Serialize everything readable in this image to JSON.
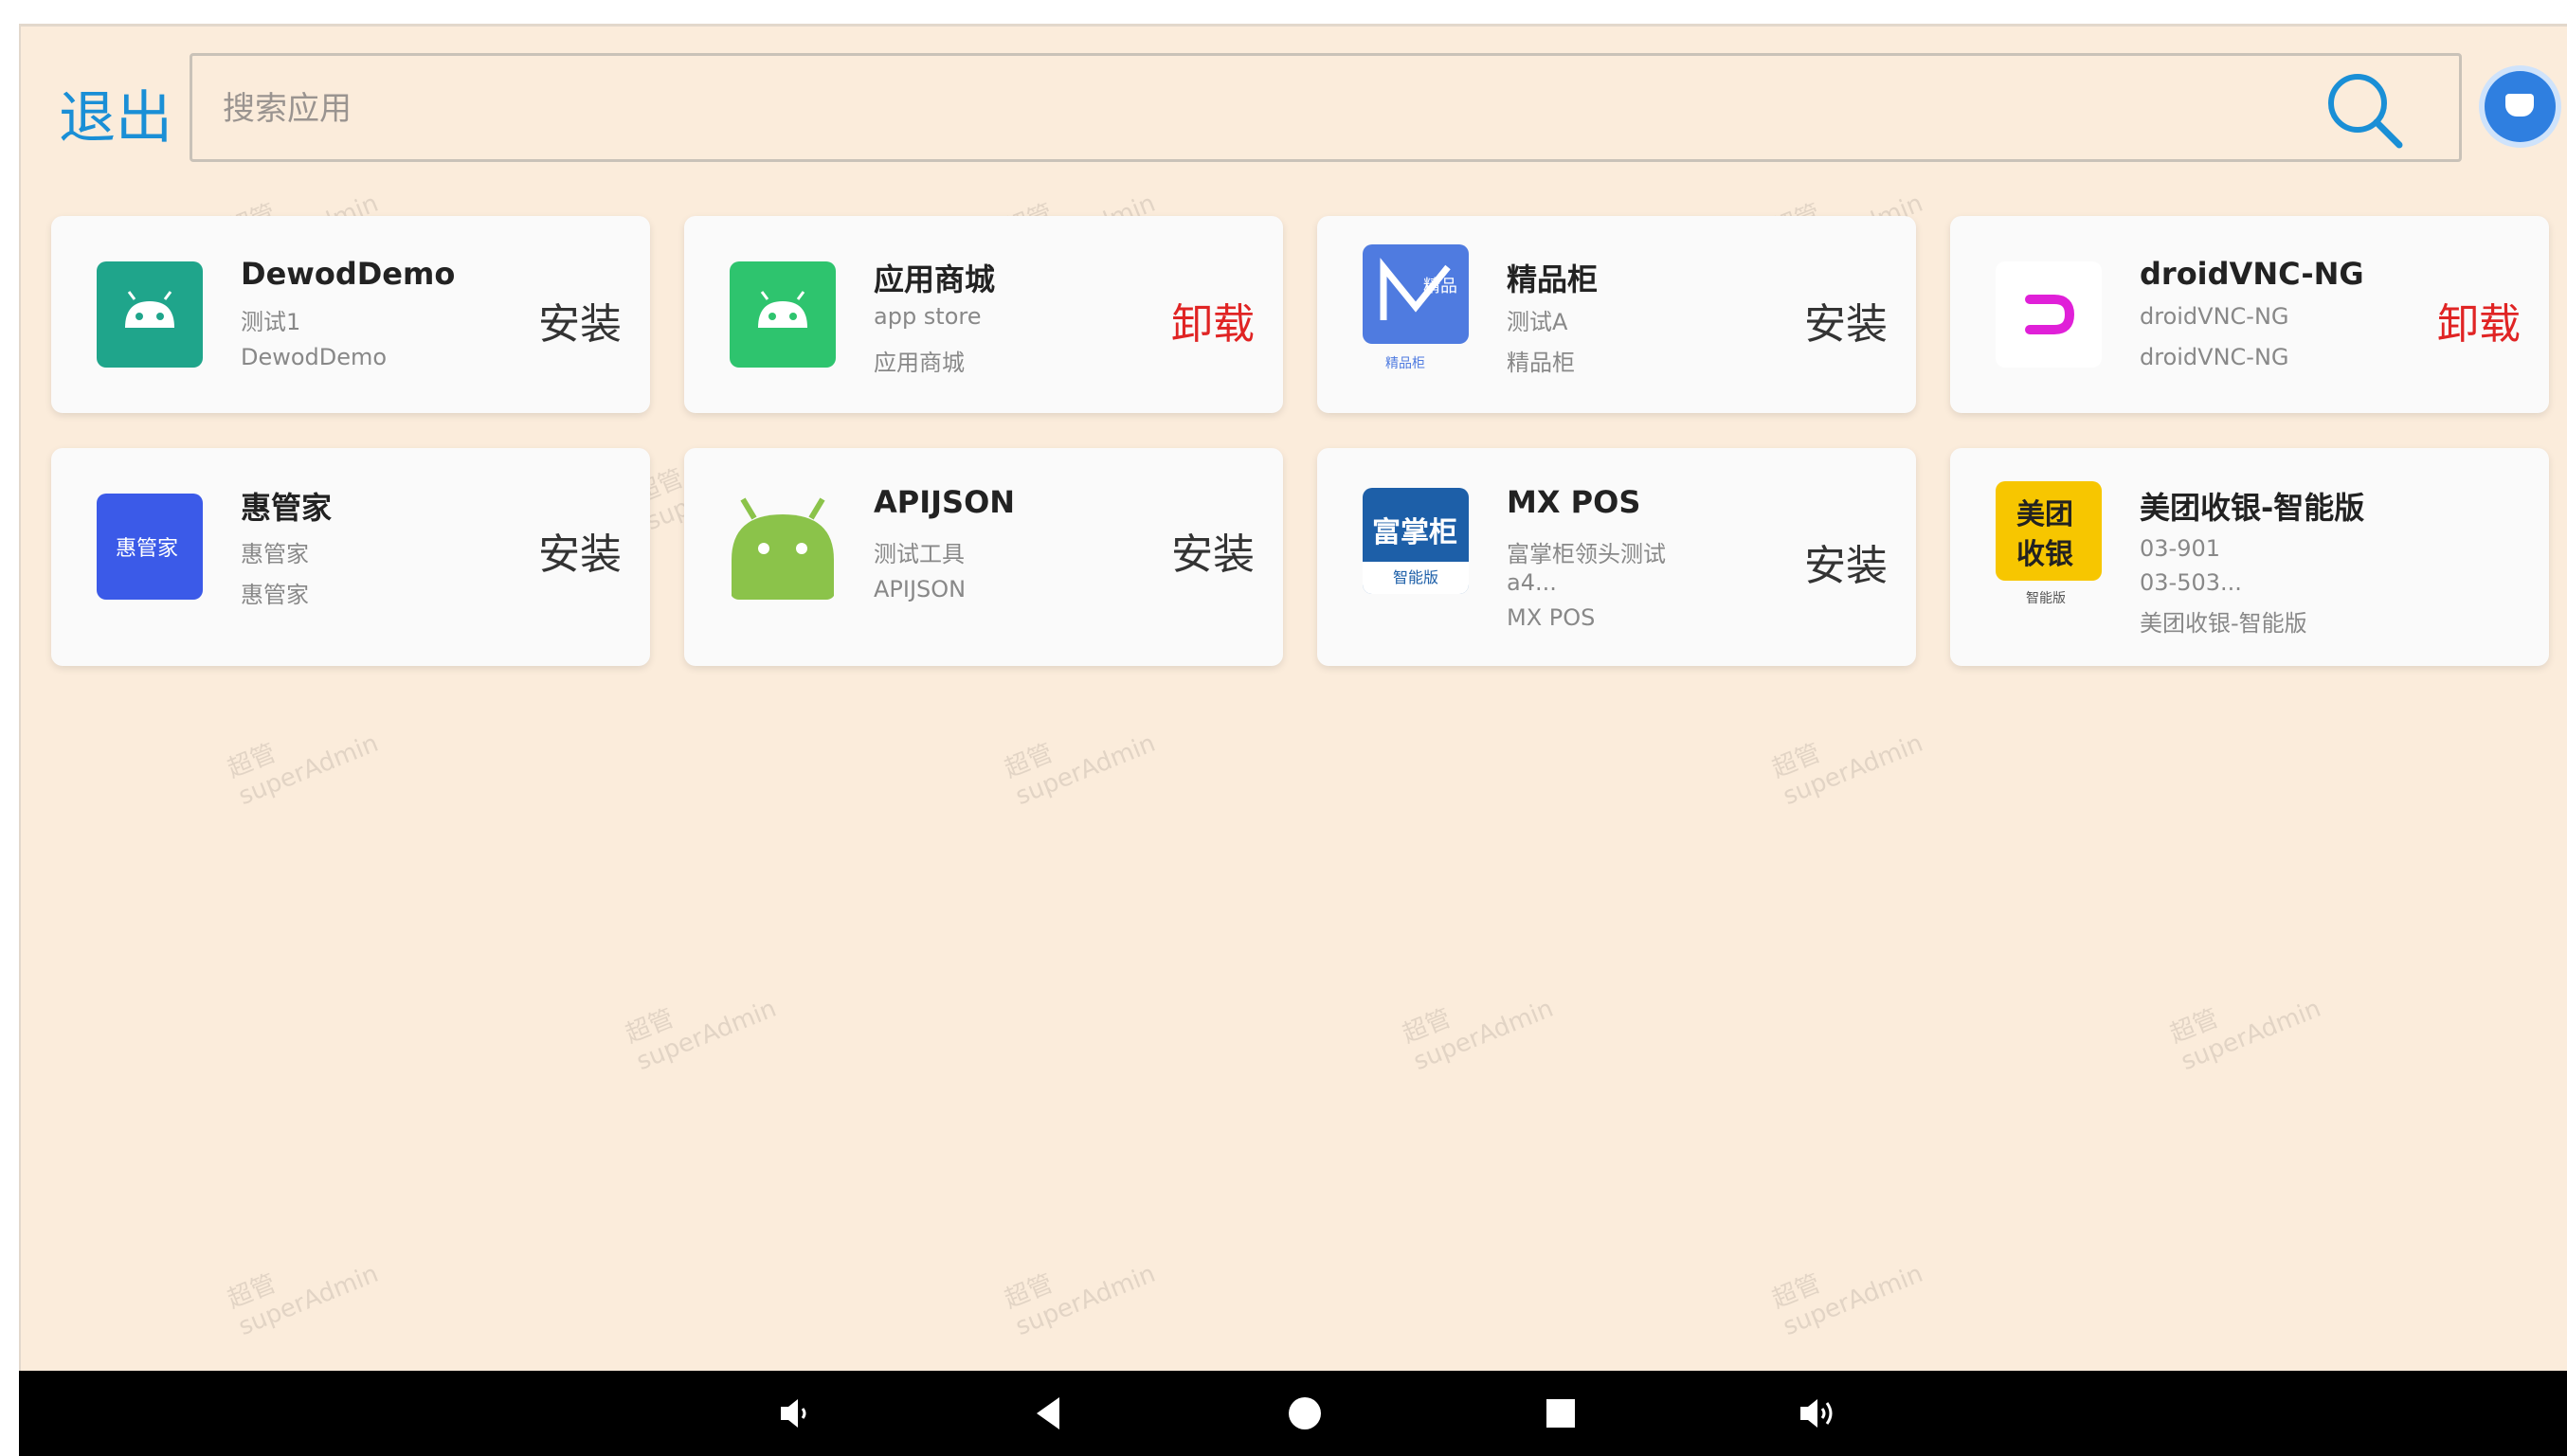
{
  "header": {
    "exit_label": "退出",
    "search_placeholder": "搜索应用"
  },
  "apps": [
    {
      "name": "DewodDemo",
      "sub1": "测试1",
      "sub2": "DewodDemo",
      "sub3": "",
      "action": "安装",
      "icon": "android-icon",
      "icon_color": "#1fa58b"
    },
    {
      "name": "应用商城",
      "sub1": "app store",
      "sub2": "应用商城",
      "sub3": "",
      "action": "卸载",
      "icon": "android-icon",
      "icon_color": "#2ec46e"
    },
    {
      "name": "精品柜",
      "sub1": "测试A",
      "sub2": "精品柜",
      "sub3": "",
      "action": "安装",
      "icon": "jingpin-icon",
      "icon_color": "#4f7be0"
    },
    {
      "name": "droidVNC-NG",
      "sub1": "droidVNC-NG",
      "sub2": "droidVNC-NG",
      "sub3": "",
      "action": "卸载",
      "icon": "vnc-icon",
      "icon_color": "#e020d8"
    },
    {
      "name": "惠管家",
      "sub1": "惠管家",
      "sub2": "惠管家",
      "sub3": "",
      "action": "安装",
      "icon": "huiguanjia-icon",
      "icon_color": "#3b5ae8"
    },
    {
      "name": "APIJSON",
      "sub1": "测试工具",
      "sub2": "APIJSON",
      "sub3": "",
      "action": "安装",
      "icon": "android-icon",
      "icon_color": "#8bc34a"
    },
    {
      "name": "MX POS",
      "sub1": "富掌柜领头测试",
      "sub2": "a4...",
      "sub3": "MX POS",
      "action": "安装",
      "icon": "fuzhanggui-icon",
      "icon_color": "#1d5fa8"
    },
    {
      "name": "美团收银-智能版",
      "sub1": "03-901",
      "sub2": "03-503...",
      "sub3": "美团收银-智能版",
      "action": "",
      "icon": "meituan-icon",
      "icon_color": "#f7c600"
    }
  ],
  "icon_labels": {
    "jingpin": "精品",
    "jingpin_caption": "精品柜",
    "huiguanjia": "惠管家",
    "fuzhanggui": "富掌柜",
    "fuzhanggui_caption": "智能版",
    "meituan_top": "美团",
    "meituan_bottom": "收银",
    "meituan_caption": "智能版"
  },
  "watermark": {
    "line1": "超管",
    "line2": "superAdmin"
  },
  "navbar": {
    "buttons": [
      "volume-down-icon",
      "back-icon",
      "home-icon",
      "recents-icon",
      "volume-up-icon"
    ]
  }
}
